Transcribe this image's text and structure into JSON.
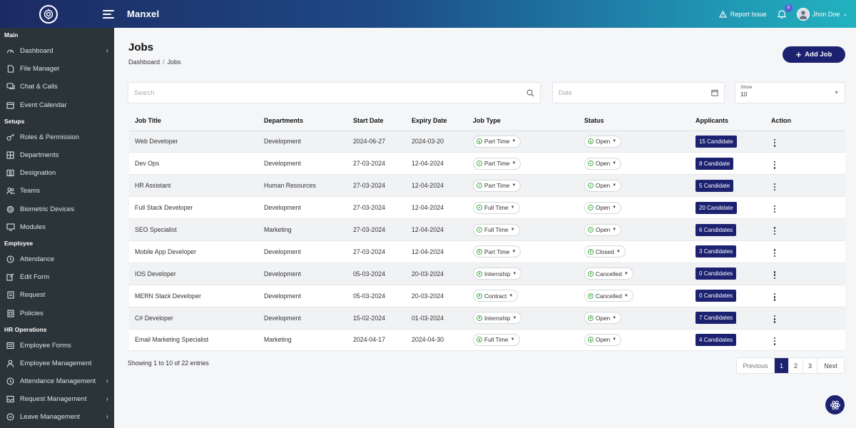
{
  "header": {
    "brand": "Manxel",
    "report_label": "Report Issue",
    "notification_count": "8",
    "user_name": "Jhon Doe"
  },
  "sidebar": {
    "sections": [
      {
        "title": "Main",
        "items": [
          {
            "label": "Dashboard",
            "icon": "gauge-icon",
            "chevron": true
          },
          {
            "label": "File Manager",
            "icon": "file-icon",
            "chevron": false
          },
          {
            "label": "Chat & Calls",
            "icon": "chat-icon",
            "chevron": false
          },
          {
            "label": "Event Calendar",
            "icon": "calendar-icon",
            "chevron": false
          }
        ]
      },
      {
        "title": "Setups",
        "items": [
          {
            "label": "Roles & Permission",
            "icon": "key-icon",
            "chevron": false
          },
          {
            "label": "Departments",
            "icon": "building-icon",
            "chevron": false
          },
          {
            "label": "Designation",
            "icon": "id-card-icon",
            "chevron": false
          },
          {
            "label": "Teams",
            "icon": "users-icon",
            "chevron": false
          },
          {
            "label": "Biometric Devices",
            "icon": "fingerprint-icon",
            "chevron": false
          },
          {
            "label": "Modules",
            "icon": "monitor-icon",
            "chevron": false
          }
        ]
      },
      {
        "title": "Employee",
        "items": [
          {
            "label": "Attendance",
            "icon": "clock-icon",
            "chevron": false
          },
          {
            "label": "Edit Form",
            "icon": "edit-icon",
            "chevron": false
          },
          {
            "label": "Request",
            "icon": "document-icon",
            "chevron": false
          },
          {
            "label": "Policies",
            "icon": "policy-icon",
            "chevron": false
          }
        ]
      },
      {
        "title": "HR Operations",
        "items": [
          {
            "label": "Employee Forms",
            "icon": "form-icon",
            "chevron": false
          },
          {
            "label": "Employee Management",
            "icon": "user-icon",
            "chevron": false
          },
          {
            "label": "Attendance Management",
            "icon": "clock-icon",
            "chevron": true
          },
          {
            "label": "Request Management",
            "icon": "inbox-icon",
            "chevron": true
          },
          {
            "label": "Leave Management",
            "icon": "leave-icon",
            "chevron": true
          }
        ]
      }
    ]
  },
  "page": {
    "title": "Jobs",
    "breadcrumb": [
      "Dashboard",
      "Jobs"
    ],
    "breadcrumb_sep": "/",
    "add_button": "Add Job"
  },
  "filters": {
    "search_placeholder": "Search",
    "date_placeholder": "Date",
    "show_label": "Show",
    "show_value": "10"
  },
  "table": {
    "columns": [
      "Job Title",
      "Departments",
      "Start Date",
      "Expiry Date",
      "Job Type",
      "Status",
      "Applicants",
      "Action"
    ],
    "rows": [
      {
        "title": "Web Developer",
        "department": "Development",
        "start": "2024-06-27",
        "expiry": "2024-03-20",
        "type": "Part Time",
        "status": "Open",
        "applicants": "15 Candidate"
      },
      {
        "title": "Dev Ops",
        "department": "Development",
        "start": "27-03-2024",
        "expiry": "12-04-2024",
        "type": "Part Time",
        "status": "Open",
        "applicants": "8 Candidate"
      },
      {
        "title": "HR Assistant",
        "department": "Human Resources",
        "start": "27-03-2024",
        "expiry": "12-04-2024",
        "type": "Part Time",
        "status": "Open",
        "applicants": "5 Candidate"
      },
      {
        "title": "Full Stack Developer",
        "department": "Development",
        "start": "27-03-2024",
        "expiry": "12-04-2024",
        "type": "Full Time",
        "status": "Open",
        "applicants": "20 Candidate"
      },
      {
        "title": "SEO Specialist",
        "department": "Marketing",
        "start": "27-03-2024",
        "expiry": "12-04-2024",
        "type": "Full Time",
        "status": "Open",
        "applicants": "6 Candidates"
      },
      {
        "title": "Mobile App Developer",
        "department": "Development",
        "start": "27-03-2024",
        "expiry": "12-04-2024",
        "type": "Part Time",
        "status": "Closed",
        "applicants": "3 Candidates"
      },
      {
        "title": "IOS Developer",
        "department": "Development",
        "start": "05-03-2024",
        "expiry": "20-03-2024",
        "type": "Internship",
        "status": "Cancelled",
        "applicants": "0 Candidates"
      },
      {
        "title": "MERN Stack Developer",
        "department": "Development",
        "start": "05-03-2024",
        "expiry": "20-03-2024",
        "type": "Contract",
        "status": "Cancelled",
        "applicants": "0 Candidates"
      },
      {
        "title": "C# Developer",
        "department": "Development",
        "start": "15-02-2024",
        "expiry": "01-03-2024",
        "type": "Internship",
        "status": "Open",
        "applicants": "7 Candidates"
      },
      {
        "title": "Email Marketing Specialist",
        "department": "Marketing",
        "start": "2024-04-17",
        "expiry": "2024-04-30",
        "type": "Full Time",
        "status": "Open",
        "applicants": "4 Candidates"
      }
    ]
  },
  "footer": {
    "entries_text": "Showing 1 to 10 of 22 entries",
    "pagination": {
      "previous": "Previous",
      "pages": [
        "1",
        "2",
        "3"
      ],
      "active": "1",
      "next": "Next"
    }
  },
  "colors": {
    "accent": "#1c2270",
    "sidebar_bg": "#2b3438",
    "status_dot": "#4caf50"
  }
}
